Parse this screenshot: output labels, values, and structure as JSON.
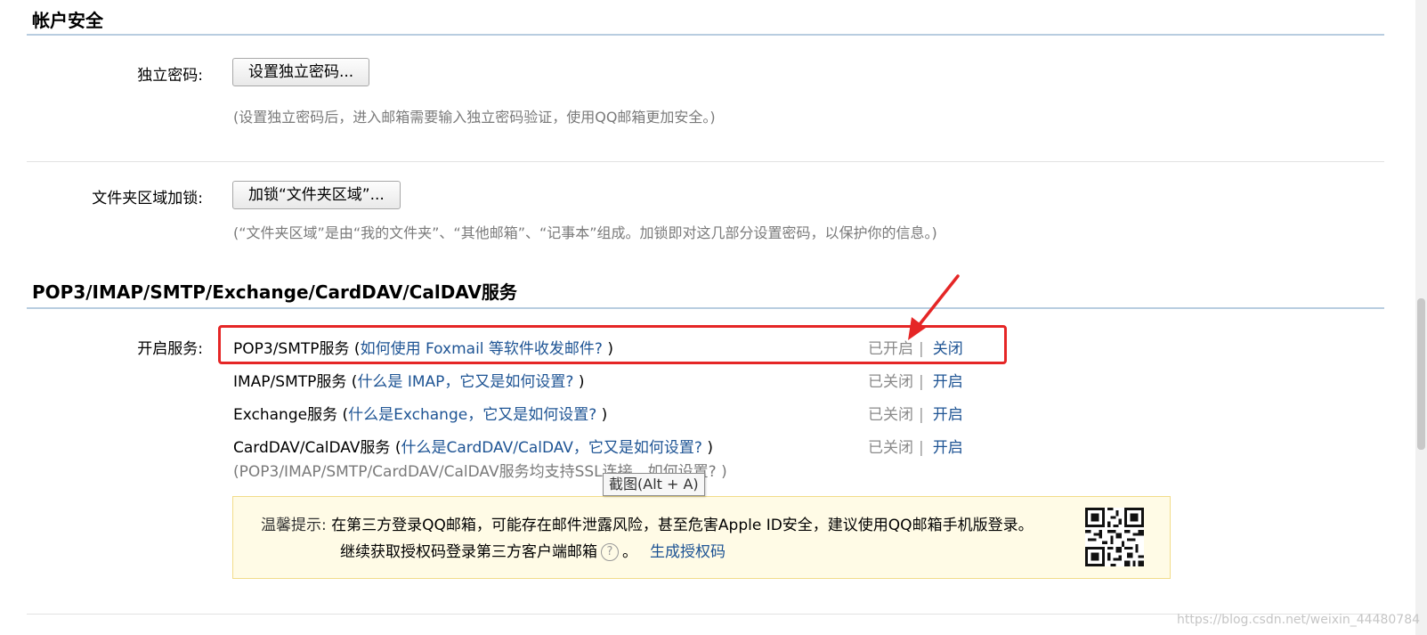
{
  "account_security": {
    "title": "帐户安全",
    "independent_password": {
      "label": "独立密码:",
      "button": "设置独立密码...",
      "hint": "(设置独立密码后，进入邮箱需要输入独立密码验证，使用QQ邮箱更加安全。)"
    },
    "folder_lock": {
      "label": "文件夹区域加锁:",
      "button": "加锁“文件夹区域”...",
      "hint": "(“文件夹区域”是由“我的文件夹”、“其他邮箱”、“记事本”组成。加锁即对这几部分设置密码，以保护你的信息。)"
    }
  },
  "services": {
    "title": "POP3/IMAP/SMTP/Exchange/CardDAV/CalDAV服务",
    "label": "开启服务:",
    "rows": [
      {
        "name": "POP3/SMTP服务",
        "open_paren": " (",
        "link": "如何使用 Foxmail 等软件收发邮件?",
        "close_paren": " )",
        "status": "已开启",
        "sep": "|",
        "action": "关闭"
      },
      {
        "name": "IMAP/SMTP服务",
        "open_paren": " (",
        "link": "什么是 IMAP，它又是如何设置?",
        "close_paren": " )",
        "status": "已关闭",
        "sep": "|",
        "action": "开启"
      },
      {
        "name": "Exchange服务",
        "open_paren": " (",
        "link": "什么是Exchange，它又是如何设置?",
        "close_paren": " )",
        "status": "已关闭",
        "sep": "|",
        "action": "开启"
      },
      {
        "name": "CardDAV/CalDAV服务",
        "open_paren": " (",
        "link": "什么是CardDAV/CalDAV，它又是如何设置?",
        "close_paren": " )",
        "status": "已关闭",
        "sep": "|",
        "action": "开启"
      }
    ],
    "ssl_note_text": "(POP3/IMAP/SMTP/CardDAV/CalDAV服务均支持SSL连接。",
    "ssl_note_link": "如何设置?",
    "ssl_note_end": " )",
    "tooltip": "截图(Alt + A)",
    "tip": {
      "label": "温馨提示:",
      "line1": "在第三方登录QQ邮箱，可能存在邮件泄露风险，甚至危害Apple ID安全，建议使用QQ邮箱手机版登录。",
      "line2": "继续获取授权码登录第三方客户端邮箱",
      "line2_end": "。",
      "help_icon": "?",
      "generate_link": "生成授权码"
    }
  },
  "watermark": "https://blog.csdn.net/weixin_44480784",
  "colors": {
    "link": "#1e5494",
    "highlight_box": "#e52626",
    "tip_background": "#fffbe6",
    "section_rule": "#b8cde0"
  },
  "icons": [
    "question-circle-icon",
    "qr-code-icon",
    "red-arrow-annotation"
  ]
}
